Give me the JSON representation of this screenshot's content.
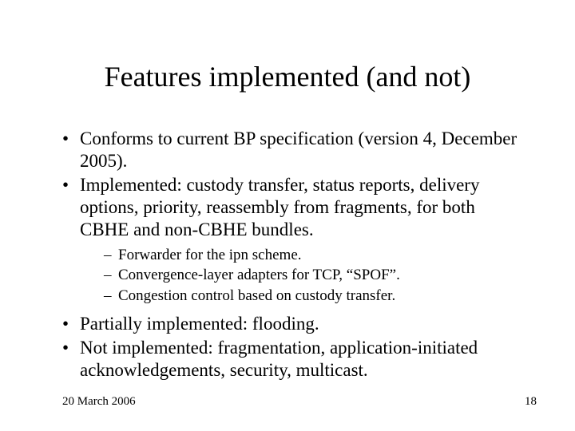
{
  "title": "Features implemented (and not)",
  "bullets": {
    "b0": "Conforms to current BP specification (version 4, December 2005).",
    "b1": "Implemented: custody transfer, status reports, delivery options, priority, reassembly from fragments, for both CBHE and non-CBHE bundles.",
    "sub": {
      "s0": "Forwarder for the ipn scheme.",
      "s1": "Convergence-layer adapters for TCP, “SPOF”.",
      "s2": "Congestion control based on custody transfer."
    },
    "b2": "Partially implemented: flooding.",
    "b3": "Not implemented: fragmentation, application-initiated acknowledgements, security, multicast."
  },
  "footer": {
    "date": "20 March 2006",
    "page": "18"
  }
}
